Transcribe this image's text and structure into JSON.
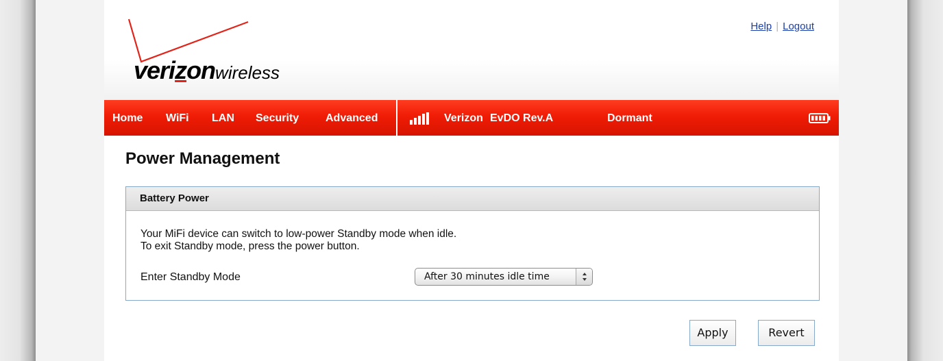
{
  "header": {
    "logo_main_prefix": "veri",
    "logo_main_z": "z",
    "logo_main_suffix": "on",
    "logo_sub": "wireless",
    "help_link": "Help",
    "separator": "|",
    "logout_link": "Logout"
  },
  "nav": {
    "items": [
      {
        "label": "Home"
      },
      {
        "label": "WiFi"
      },
      {
        "label": "LAN"
      },
      {
        "label": "Security"
      },
      {
        "label": "Advanced"
      }
    ],
    "carrier": "Verizon",
    "network": "EvDO Rev.A",
    "connection_status": "Dormant",
    "signal_icon": "signal-bars-icon",
    "battery_icon": "battery-icon"
  },
  "main": {
    "title": "Power Management",
    "panel": {
      "heading": "Battery Power",
      "desc_line1": "Your MiFi device can switch to low-power Standby mode when idle.",
      "desc_line2": "To exit Standby mode, press the power button.",
      "standby_label": "Enter Standby Mode",
      "standby_value": "After 30 minutes idle time"
    },
    "apply_label": "Apply",
    "revert_label": "Revert"
  },
  "colors": {
    "nav_red": "#e8200a",
    "link_blue": "#1b3ea8",
    "panel_border": "#86a8c9",
    "logo_red": "#e1241a"
  }
}
